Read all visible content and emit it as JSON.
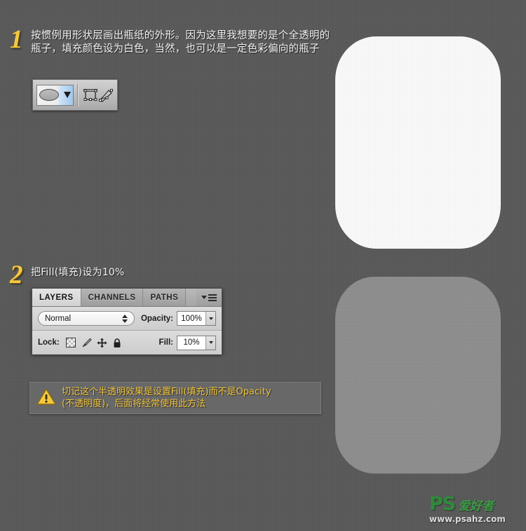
{
  "background": {
    "color": "#575757",
    "texture": "noise"
  },
  "steps": [
    {
      "number": "1",
      "text": "按惯例用形状层画出瓶纸的外形。因为这里我想要的是个全透明的瓶子，填充颜色设为白色，当然，也可以是一定色彩偏向的瓶子"
    },
    {
      "number": "2",
      "text": "把Fill(填充)设为10%"
    }
  ],
  "shape_toolbar": {
    "shape_picker": {
      "icon": "ellipse-shape-icon",
      "dropdown_icon": "caret-down-icon"
    },
    "path_selection_icon": "path-selection-icon",
    "pen_tool_icon": "pen-tool-icon"
  },
  "layers_panel": {
    "tabs": [
      {
        "label": "LAYERS",
        "active": true
      },
      {
        "label": "CHANNELS",
        "active": false
      },
      {
        "label": "PATHS",
        "active": false
      }
    ],
    "menu_icon": "panel-menu-icon",
    "blend_mode": {
      "value": "Normal"
    },
    "opacity": {
      "label": "Opacity:",
      "value": "100%"
    },
    "lock": {
      "label": "Lock:",
      "icons": [
        "lock-transparent-pixels-icon",
        "lock-image-pixels-icon",
        "lock-position-icon",
        "lock-all-icon"
      ]
    },
    "fill": {
      "label": "Fill:",
      "value": "10%"
    }
  },
  "warning": {
    "icon": "warning-triangle-icon",
    "line1": "切记这个半透明效果是设置Fill(填充)而不是Opacity",
    "line2": "(不透明度)，后面将经常使用此方法",
    "text_color": "#f0c23c"
  },
  "artwork": {
    "bottle_white": {
      "label": "white-bottle-shape",
      "color": "#ffffff"
    },
    "bottle_gray": {
      "label": "filled-10-percent-bottle-shape",
      "color": "#8e8e8e"
    }
  },
  "watermark": {
    "brand": "PS",
    "brand_cn": "爱好者",
    "url": "www.psahz.com"
  }
}
